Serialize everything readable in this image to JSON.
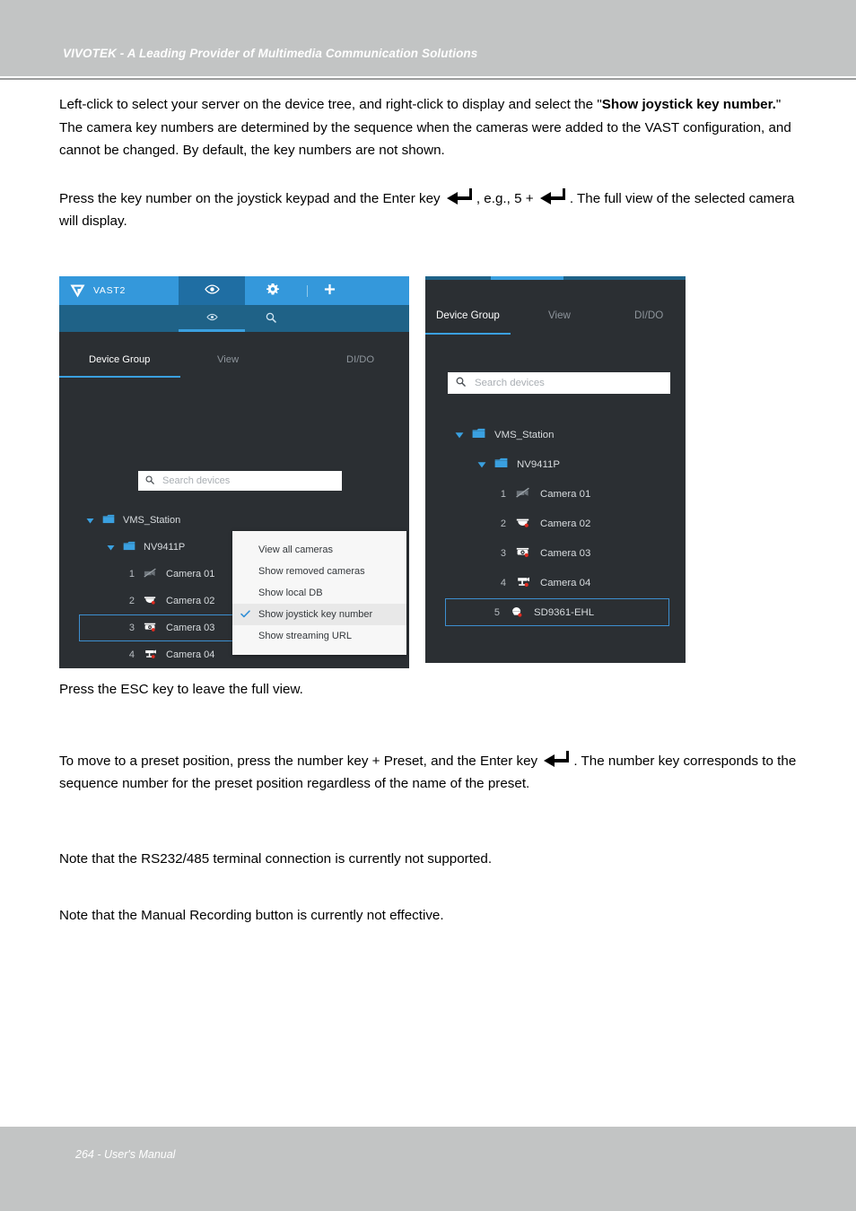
{
  "header": {
    "title": "VIVOTEK - A Leading Provider of Multimedia Communication Solutions"
  },
  "footer": {
    "text": "264 - User's Manual"
  },
  "body": {
    "para1_a": "Left-click to select your server on the device tree, and right-click to display and select the \"",
    "para1_bold": "Show joystick key number.",
    "para1_b": "\" The camera key numbers are determined by the sequence when the cameras were added to the VAST configuration, and cannot be changed. By default, the key numbers are not shown.",
    "para2_a": "Press the key number on the joystick keypad and the Enter key ",
    "para2_b": ", e.g., 5 + ",
    "para2_c": ". The full view of the selected camera will display.",
    "para3": "Press the ESC key to leave the full view.",
    "para4_a": "To move to a preset position, press the number key + Preset, and the Enter key ",
    "para4_b": ". The number key corresponds to the sequence number for the preset position regardless of the name of the preset.",
    "para5": "Note that the RS232/485 terminal connection is currently not supported.",
    "para6": "Note that the Manual Recording button is currently not effective."
  },
  "left_shot": {
    "brand": "VAST2",
    "topbar_icons": [
      "eye-icon",
      "gear-icon",
      "plus-icon"
    ],
    "subbar_icons": [
      "eye-icon",
      "search-icon"
    ],
    "tabs": [
      {
        "label": "Device Group",
        "active": true
      },
      {
        "label": "View",
        "active": false
      },
      {
        "label": "DI/DO",
        "active": false
      }
    ],
    "search": {
      "placeholder": "Search devices",
      "value": ""
    },
    "tree": [
      {
        "label": "VMS_Station",
        "type": "folder",
        "depth": 0,
        "expanded": true
      },
      {
        "label": "NV9411P",
        "type": "folder",
        "depth": 1,
        "expanded": true
      },
      {
        "num": "1",
        "label": "Camera 01",
        "type": "camera-disabled",
        "depth": 2
      },
      {
        "num": "2",
        "label": "Camera 02",
        "type": "camera-dome",
        "depth": 2
      },
      {
        "num": "3",
        "label": "Camera 03",
        "type": "camera-fisheye",
        "depth": 2,
        "selected": true
      },
      {
        "num": "4",
        "label": "Camera 04",
        "type": "camera-bullet",
        "depth": 2
      }
    ],
    "context_menu": [
      {
        "label": "View all cameras",
        "checked": false
      },
      {
        "label": "Show removed cameras",
        "checked": false
      },
      {
        "label": "Show local DB",
        "checked": false
      },
      {
        "label": "Show joystick key number",
        "checked": true
      },
      {
        "label": "Show streaming URL",
        "checked": false
      }
    ]
  },
  "right_shot": {
    "tabs": [
      {
        "label": "Device Group",
        "active": true
      },
      {
        "label": "View",
        "active": false
      },
      {
        "label": "DI/DO",
        "active": false
      }
    ],
    "search": {
      "placeholder": "Search devices",
      "value": ""
    },
    "tree": [
      {
        "label": "VMS_Station",
        "type": "folder",
        "depth": 0,
        "expanded": true
      },
      {
        "label": "NV9411P",
        "type": "folder",
        "depth": 1,
        "expanded": true
      },
      {
        "num": "1",
        "label": "Camera 01",
        "type": "camera-disabled",
        "depth": 2
      },
      {
        "num": "2",
        "label": "Camera 02",
        "type": "camera-dome",
        "depth": 2
      },
      {
        "num": "3",
        "label": "Camera 03",
        "type": "camera-fisheye",
        "depth": 2
      },
      {
        "num": "4",
        "label": "Camera 04",
        "type": "camera-bullet",
        "depth": 2
      },
      {
        "num": "5",
        "label": "SD9361-EHL",
        "type": "camera-speeddome",
        "depth": 2,
        "selected": true
      }
    ]
  },
  "colors": {
    "header_band": "#c2c4c4",
    "accent_blue": "#3498db",
    "accent_dark_blue": "#1f6287",
    "panel_bg": "#2b2f33",
    "selection_border": "#3d8fd0",
    "status_red": "#e02b20"
  }
}
